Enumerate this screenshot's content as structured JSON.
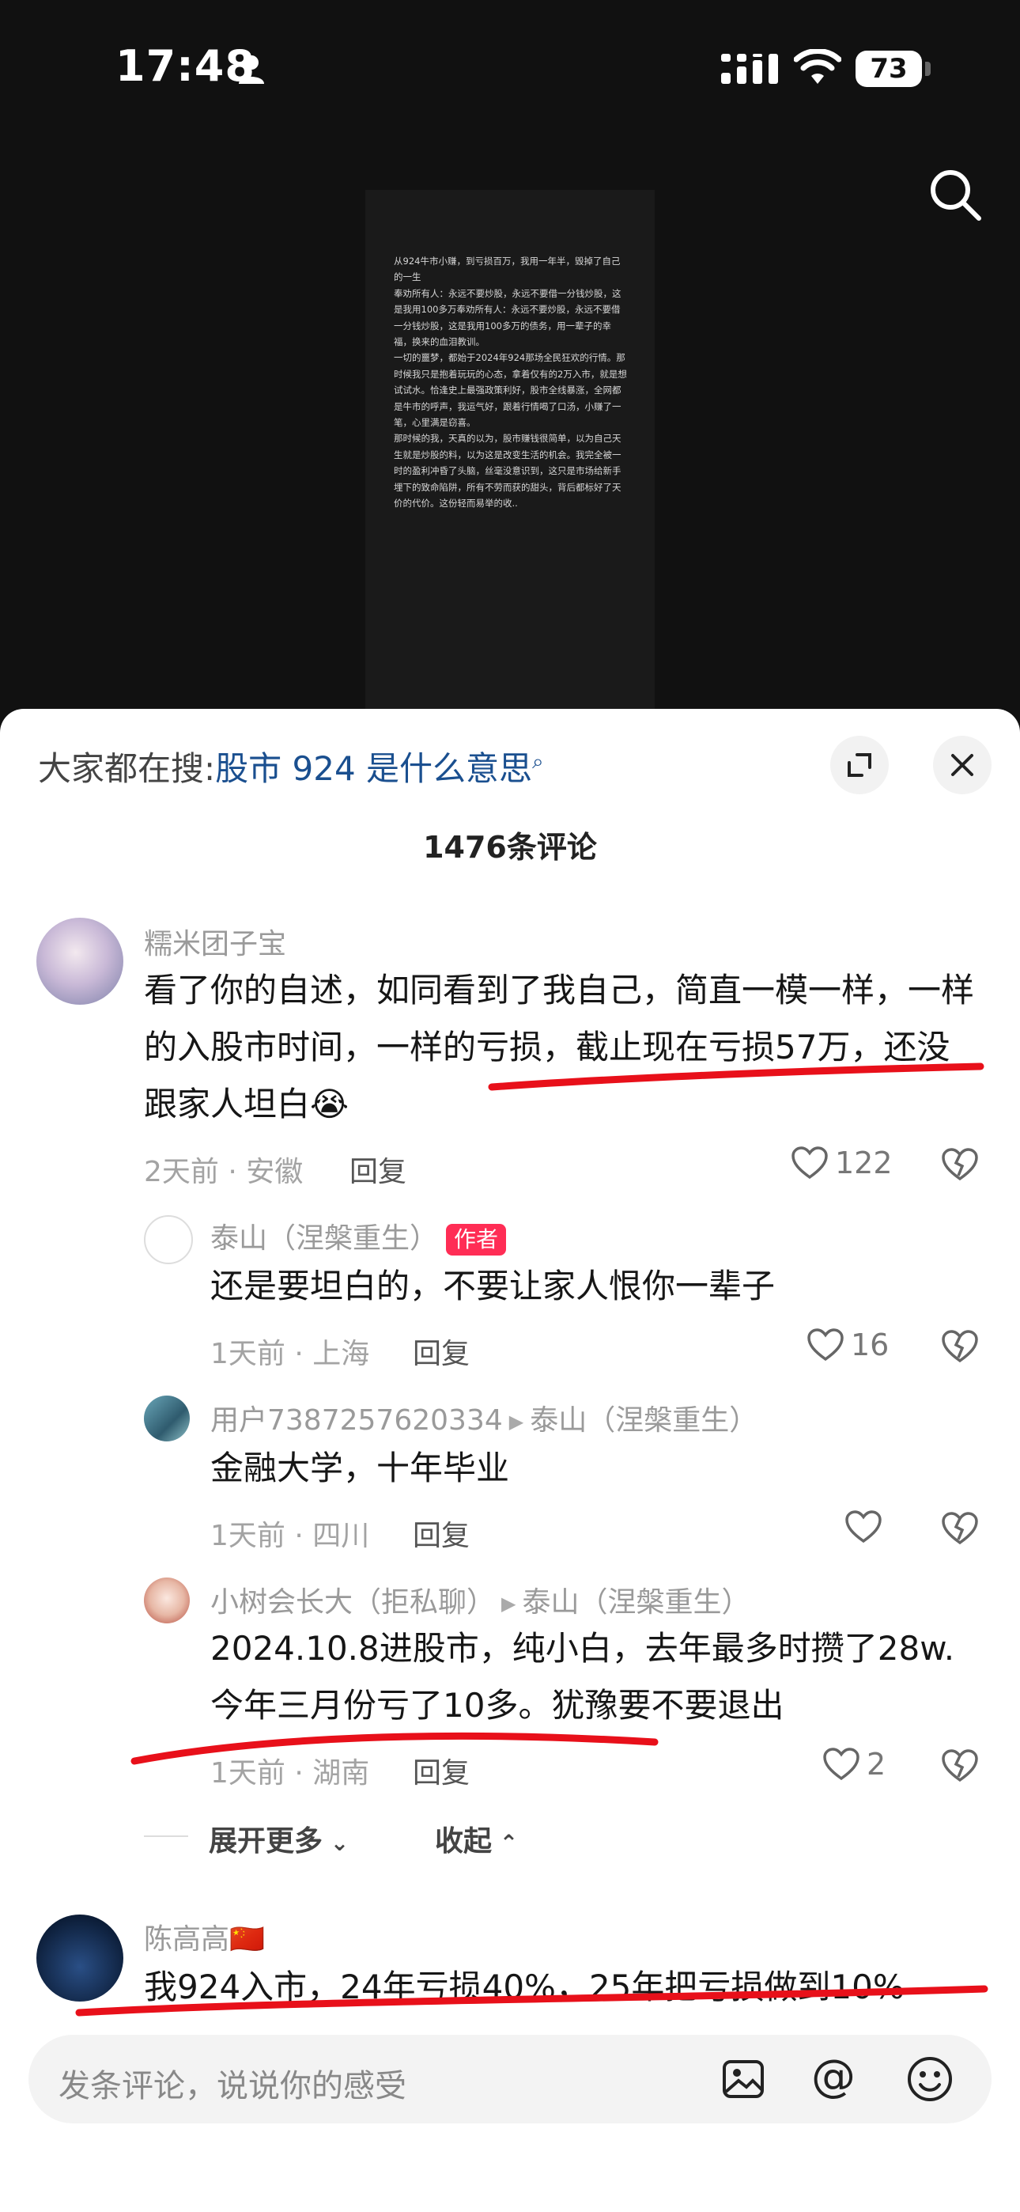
{
  "status": {
    "time": "17:48",
    "battery": "73"
  },
  "video_text": "从924牛市小赚，到亏损百万，我用一年半，毁掉了自己的一生\n奉劝所有人：永远不要炒股，永远不要借一分钱炒股，这是我用100多万奉劝所有人：永远不要炒股，永远不要借一分钱炒股，这是我用100多万的债务，用一辈子的幸福，换来的血泪教训。\n一切的噩梦，都始于2024年924那场全民狂欢的行情。那时候我只是抱着玩玩的心态，拿着仅有的2万入市，就是想试试水。恰逢史上最强政策利好，股市全线暴涨，全网都是牛市的呼声，我运气好，跟着行情喝了口汤，小赚了一笔，心里满是窃喜。\n那时候的我，天真的以为，股市赚钱很简单，以为自己天生就是炒股的料，以为这是改变生活的机会。我完全被一时的盈利冲昏了头脑，丝毫没意识到，这只是市场给新手埋下的致命陷阱，所有不劳而获的甜头，背后都标好了天价的代价。这份轻而易举的收..",
  "sheet": {
    "search_prefix": "大家都在搜:",
    "search_link": "股市 924 是什么意思",
    "comments_count": "1476条评论",
    "expand_more": "展开更多",
    "collapse": "收起",
    "input_placeholder": "发条评论，说说你的感受"
  },
  "comments": [
    {
      "user": "糯米团子宝",
      "text": "看了你的自述，如同看到了我自己，简直一模一样，一样的入股市时间，一样的亏损，截止现在亏损57万，还没跟家人坦白😭",
      "meta": "2天前 · 安徽",
      "reply": "回复",
      "likes": "122"
    },
    {
      "user": "泰山（涅槃重生）",
      "badge": "作者",
      "text": "还是要坦白的，不要让家人恨你一辈子",
      "meta": "1天前 · 上海",
      "reply": "回复",
      "likes": "16"
    },
    {
      "user": "用户7387257620334",
      "reply_to": "泰山（涅槃重生）",
      "text": "金融大学，十年毕业",
      "meta": "1天前 · 四川",
      "reply": "回复",
      "likes": ""
    },
    {
      "user": "小树会长大（拒私聊）",
      "reply_to": "泰山（涅槃重生）",
      "text": "2024.10.8进股市，纯小白，去年最多时攒了28w.今年三月份亏了10多。犹豫要不要退出",
      "meta": "1天前 · 湖南",
      "reply": "回复",
      "likes": "2"
    },
    {
      "user": "陈高高🇨🇳",
      "text": "我924入市，24年亏损40%，25年把亏损做到10%"
    }
  ],
  "colors": {
    "accent_link": "#1a4f8f",
    "author_badge": "#ff2d55",
    "annotation": "#e8101a"
  }
}
